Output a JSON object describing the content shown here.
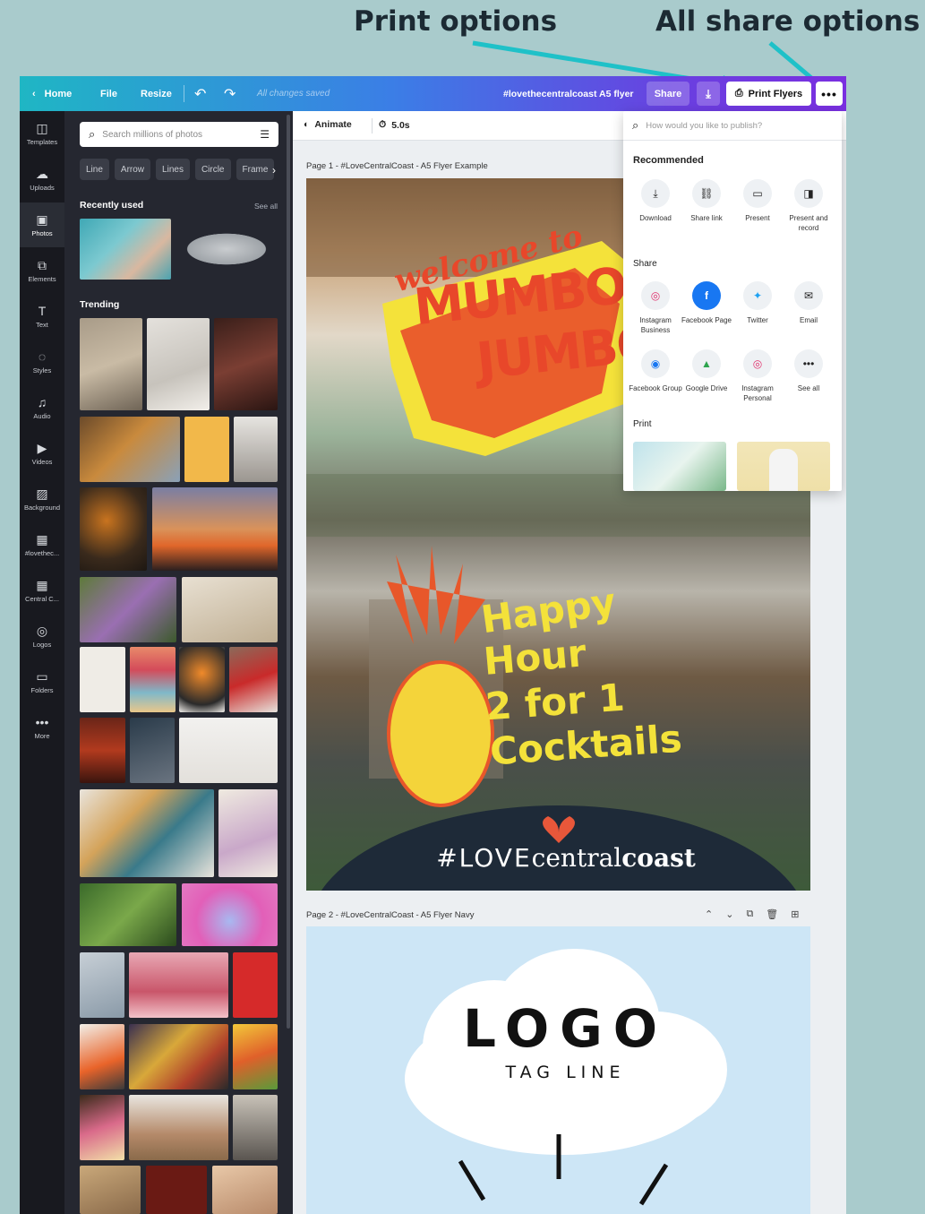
{
  "annotations": {
    "print_options": "Print options",
    "all_share_options": "All share options"
  },
  "topbar": {
    "home": "Home",
    "file": "File",
    "resize": "Resize",
    "saved": "All changes saved",
    "title": "#lovethecentralcoast A5 flyer",
    "share": "Share",
    "print": "Print Flyers"
  },
  "sidebar": {
    "items": [
      {
        "label": "Templates",
        "icon": "templates-icon",
        "glyph": "◫"
      },
      {
        "label": "Uploads",
        "icon": "upload-icon",
        "glyph": "☁"
      },
      {
        "label": "Photos",
        "icon": "photos-icon",
        "glyph": "▣"
      },
      {
        "label": "Elements",
        "icon": "elements-icon",
        "glyph": "⧉"
      },
      {
        "label": "Text",
        "icon": "text-icon",
        "glyph": "T"
      },
      {
        "label": "Styles",
        "icon": "styles-icon",
        "glyph": "◌"
      },
      {
        "label": "Audio",
        "icon": "audio-icon",
        "glyph": "♫"
      },
      {
        "label": "Videos",
        "icon": "videos-icon",
        "glyph": "▶"
      },
      {
        "label": "Background",
        "icon": "background-icon",
        "glyph": "▨"
      },
      {
        "label": "#lovethec...",
        "icon": "folder-thumb-icon",
        "glyph": "▦"
      },
      {
        "label": "Central C...",
        "icon": "folder-thumb-icon",
        "glyph": "▦"
      },
      {
        "label": "Logos",
        "icon": "logos-icon",
        "glyph": "◎"
      },
      {
        "label": "Folders",
        "icon": "folders-icon",
        "glyph": "▭"
      },
      {
        "label": "More",
        "icon": "more-icon",
        "glyph": "•••"
      }
    ]
  },
  "panel": {
    "search_placeholder": "Search millions of photos",
    "chips": [
      "Line",
      "Arrow",
      "Lines",
      "Circle",
      "Frame"
    ],
    "recently_used": "Recently used",
    "see_all": "See all",
    "trending": "Trending"
  },
  "editor": {
    "animate": "Animate",
    "duration": "5.0s",
    "page1_label": "Page 1 - #LoveCentralCoast - A5 Flyer Example",
    "page2_label": "Page 2 - #LoveCentralCoast - A5 Flyer Navy"
  },
  "flyer1": {
    "welcome": "welcome to",
    "mumbo": "MUMBO",
    "jumbo": "JUMBO",
    "happy": "Happy",
    "hour": "Hour",
    "deal": "2 for 1",
    "cocktails": "Cocktails",
    "hashtag_love": "#LOVE",
    "hashtag_central": "central",
    "hashtag_coast": "coast"
  },
  "flyer2": {
    "logo": "LOGO",
    "tagline": "TAG LINE"
  },
  "popup": {
    "search_placeholder": "How would you like to publish?",
    "recommended": "Recommended",
    "recommended_items": [
      {
        "label": "Download",
        "icon": "download-icon",
        "glyph": "⤓"
      },
      {
        "label": "Share link",
        "icon": "link-icon",
        "glyph": "⛓"
      },
      {
        "label": "Present",
        "icon": "present-icon",
        "glyph": "▭"
      },
      {
        "label": "Present and record",
        "icon": "record-icon",
        "glyph": "◨"
      }
    ],
    "share": "Share",
    "share_items": [
      {
        "label": "Instagram Business",
        "icon": "instagram-icon",
        "glyph": "◎",
        "color": "#e1306c"
      },
      {
        "label": "Facebook Page",
        "icon": "facebook-icon",
        "glyph": "f",
        "color": "#1877f2"
      },
      {
        "label": "Twitter",
        "icon": "twitter-icon",
        "glyph": "✦",
        "color": "#1da1f2"
      },
      {
        "label": "Email",
        "icon": "email-icon",
        "glyph": "✉",
        "color": "#222222"
      },
      {
        "label": "Facebook Group",
        "icon": "facebook-group-icon",
        "glyph": "◉",
        "color": "#1877f2"
      },
      {
        "label": "Google Drive",
        "icon": "google-drive-icon",
        "glyph": "▲",
        "color": "#2da44e"
      },
      {
        "label": "Instagram Personal",
        "icon": "instagram-icon",
        "glyph": "◎",
        "color": "#e1306c"
      },
      {
        "label": "See all",
        "icon": "more-icon",
        "glyph": "•••",
        "color": "#222222"
      }
    ],
    "print": "Print"
  }
}
